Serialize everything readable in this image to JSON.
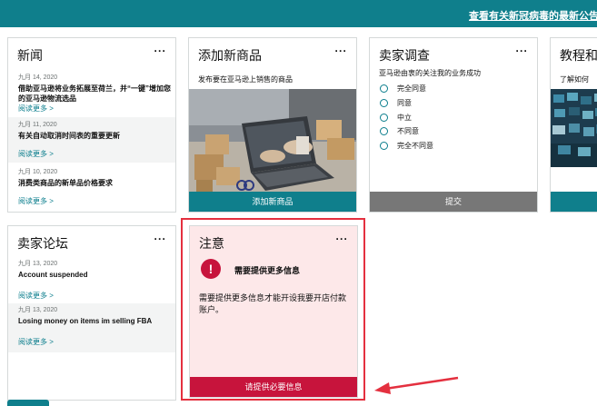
{
  "banner": {
    "link_text": "查看有关新冠病毒的最新公告"
  },
  "news": {
    "title": "新闻",
    "items": [
      {
        "date": "九月 14, 2020",
        "title": "借助亚马逊将业务拓展至荷兰，并“一键”增加您的亚马逊物流选品",
        "more": "阅读更多 >"
      },
      {
        "date": "九月 11, 2020",
        "title": "有关自动取消时间表的重要更新",
        "more": "阅读更多 >"
      },
      {
        "date": "九月 10, 2020",
        "title": "消费类商品的新单品价格要求",
        "more": "阅读更多 >"
      }
    ]
  },
  "add_product": {
    "title": "添加新商品",
    "subtitle": "发布要在亚马逊上销售的商品",
    "button": "添加新商品"
  },
  "survey": {
    "title": "卖家调查",
    "question": "亚马逊由衷的关注我的业务成功",
    "options": [
      "完全同意",
      "同意",
      "中立",
      "不同意",
      "完全不同意"
    ],
    "submit": "提交"
  },
  "tutorial": {
    "title": "教程和",
    "subtitle": "了解如何"
  },
  "forum": {
    "title": "卖家论坛",
    "items": [
      {
        "date": "九月 13, 2020",
        "title": "Account suspended",
        "more": "阅读更多 >"
      },
      {
        "date": "九月 13, 2020",
        "title": "Losing money on items im selling FBA",
        "more": "阅读更多 >"
      }
    ]
  },
  "notice": {
    "title": "注意",
    "alert_title": "需要提供更多信息",
    "body": "需要提供更多信息才能开设我要开店付款账户。",
    "button": "请提供必要信息"
  },
  "colors": {
    "teal": "#0f7f8c",
    "alert_red": "#c7143c",
    "highlight": "#e4303f"
  }
}
